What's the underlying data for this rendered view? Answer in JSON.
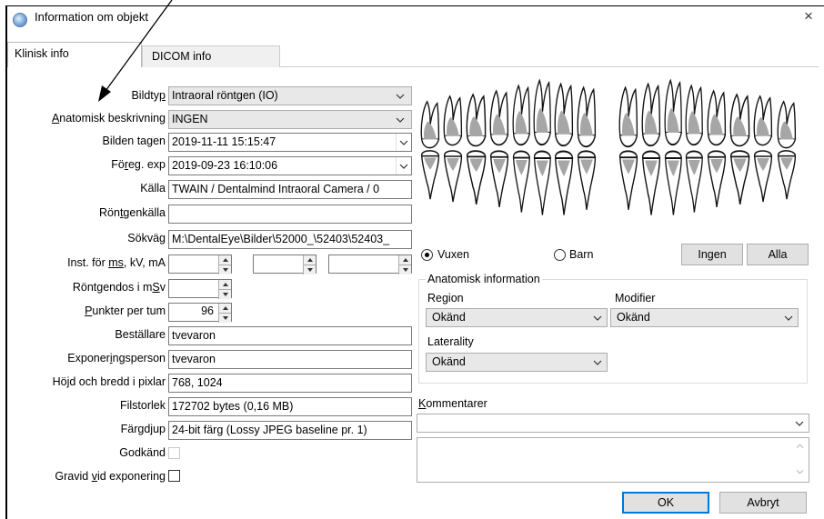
{
  "window": {
    "title": "Information om objekt",
    "close_glyph": "×"
  },
  "tabs": [
    {
      "label": "Klinisk info",
      "active": true
    },
    {
      "label": "DICOM info",
      "active": false
    }
  ],
  "form": {
    "bildtyp": {
      "label_pre": "Bildty",
      "label_u": "p",
      "label_post": "",
      "value": "Intraoral röntgen (IO)"
    },
    "anatomisk": {
      "label_pre": "",
      "label_u": "A",
      "label_post": "natomisk beskrivning",
      "value": "INGEN"
    },
    "bilden_tagen": {
      "label": "Bilden tagen",
      "value": "2019-11-11 15:15:47"
    },
    "foreg_exp": {
      "label_pre": "Fö",
      "label_u": "r",
      "label_post": "eg. exp",
      "value": "2019-09-23 16:10:06"
    },
    "kalla": {
      "label": "Källa",
      "value": "TWAIN / Dentalmind Intraoral Camera / 0"
    },
    "rontgenkalla": {
      "label_pre": "Rön",
      "label_u": "t",
      "label_post": "genkälla",
      "value": ""
    },
    "sokvag": {
      "label": "Sökväg",
      "value": "M:\\DentalEye\\Bilder\\52000_\\52403\\52403_"
    },
    "inst": {
      "label_pre": "Inst. för ",
      "label_u": "ms",
      "label_post": ", kV, mA",
      "values": [
        "",
        "",
        ""
      ]
    },
    "rontgendos": {
      "label_pre": "Röntgendos i m",
      "label_u": "S",
      "label_post": "v",
      "value": ""
    },
    "punkter": {
      "label_pre": "",
      "label_u": "P",
      "label_post": "unkter per tum",
      "value": "96"
    },
    "bestallare": {
      "label": "Beställare",
      "value": "tvevaron"
    },
    "exponeringsperson": {
      "label_pre": "Exponer",
      "label_u": "i",
      "label_post": "ngsperson",
      "value": "tvevaron"
    },
    "hojd_bredd": {
      "label": "Höjd och bredd i pixlar",
      "value": "768, 1024"
    },
    "filstorlek": {
      "label": "Filstorlek",
      "value": "172702 bytes (0,16 MB)"
    },
    "fargdjup": {
      "label": "Färgdjup",
      "value": "24-bit färg (Lossy JPEG baseline pr. 1)"
    },
    "godkand": {
      "label": "Godkänd",
      "checked": false
    },
    "gravid": {
      "label_pre": "Gravid ",
      "label_u": "v",
      "label_post": "id exponering",
      "checked": false
    }
  },
  "dentition": {
    "vuxen": "Vuxen",
    "barn": "Barn",
    "selected": "Vuxen",
    "ingen_label": "Ingen",
    "alla_label": "Alla"
  },
  "anatomisk_info": {
    "group_title": "Anatomisk information",
    "region_label": "Region",
    "region_value": "Okänd",
    "modifier_label": "Modifier",
    "modifier_value": "Okänd",
    "laterality_label": "Laterality",
    "laterality_value": "Okänd"
  },
  "kommentarer": {
    "label_u": "K",
    "label_post": "ommentarer",
    "value": ""
  },
  "buttons": {
    "ok": "OK",
    "avbryt": "Avbryt"
  },
  "icons": {
    "window": "app-globe-icon",
    "annotation": "arrow-annotation-icon"
  }
}
